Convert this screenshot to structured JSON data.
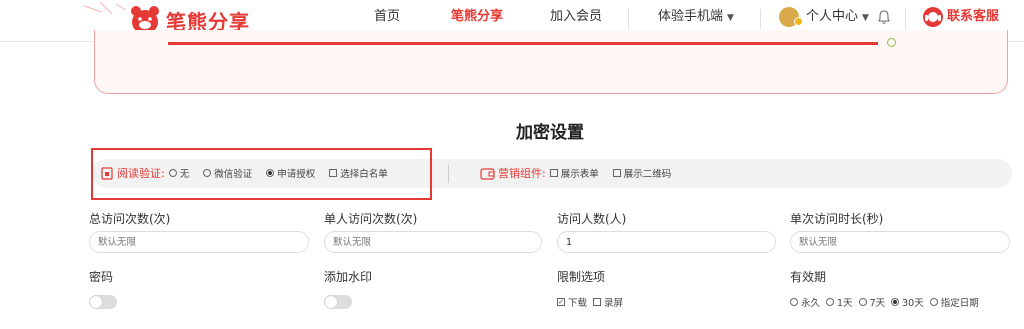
{
  "brand": {
    "name": "笔熊分享",
    "color": "#e53935"
  },
  "nav": {
    "items": [
      {
        "label": "首页"
      },
      {
        "label": "笔熊分享",
        "active": true
      },
      {
        "label": "加入会员"
      },
      {
        "label": "体验手机端"
      }
    ],
    "user_center": "个人中心",
    "service": "联系客服"
  },
  "encryption": {
    "title": "加密设置",
    "verify_label": "阅读验证:",
    "verify_options": [
      {
        "label": "无",
        "selected": false
      },
      {
        "label": "微信验证",
        "selected": false
      },
      {
        "label": "申请授权",
        "selected": true
      },
      {
        "label": "选择白名单",
        "checkbox": true,
        "checked": false
      }
    ],
    "marketing_label": "营销组件:",
    "marketing_options": [
      {
        "label": "展示表单",
        "checked": false
      },
      {
        "label": "展示二维码",
        "checked": false
      }
    ]
  },
  "fields": [
    {
      "label": "总访问次数(次)",
      "placeholder": "默认无限"
    },
    {
      "label": "单人访问次数(次)",
      "placeholder": "默认无限"
    },
    {
      "label": "访问人数(人)",
      "value": "1"
    },
    {
      "label": "单次访问时长(秒)",
      "placeholder": "默认无限"
    }
  ],
  "settings": {
    "password_label": "密码",
    "password_enabled": false,
    "watermark_label": "添加水印",
    "watermark_enabled": false,
    "limit_label": "限制选项",
    "limit_options": [
      {
        "label": "下载",
        "checked": true
      },
      {
        "label": "录屏",
        "checked": false
      }
    ],
    "validity_label": "有效期",
    "validity_options": [
      {
        "label": "永久",
        "selected": false
      },
      {
        "label": "1天",
        "selected": false
      },
      {
        "label": "7天",
        "selected": false
      },
      {
        "label": "30天",
        "selected": true
      },
      {
        "label": "指定日期",
        "selected": false
      }
    ]
  }
}
